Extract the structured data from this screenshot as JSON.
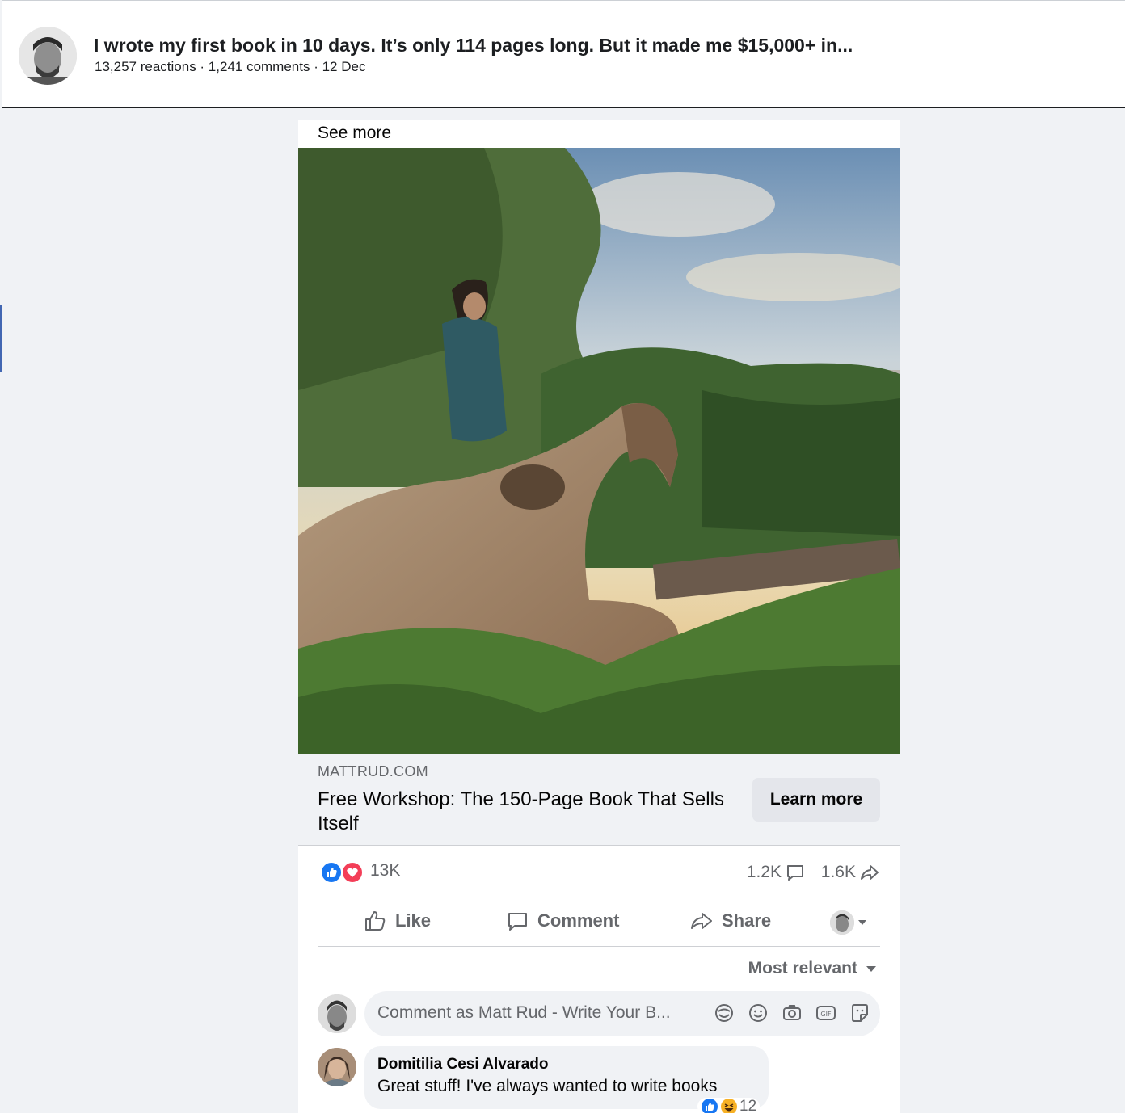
{
  "header": {
    "title": "I wrote my first book in 10 days. It’s only 114 pages long. But it made me $15,000+ in...",
    "meta": "13,257 reactions · 1,241 comments · 12 Dec"
  },
  "post": {
    "see_more": "See more",
    "link": {
      "domain": "MATTRUD.COM",
      "title": "Free Workshop: The 150-Page Book That Sells Itself",
      "cta": "Learn more"
    },
    "stats": {
      "reactions": "13K",
      "comments": "1.2K",
      "shares": "1.6K"
    },
    "actions": {
      "like": "Like",
      "comment": "Comment",
      "share": "Share"
    },
    "sort": "Most relevant",
    "composer_placeholder": "Comment as Matt Rud - Write Your B...",
    "comment": {
      "author": "Domitilia Cesi Alvarado",
      "text": "Great stuff! I've always wanted to write books",
      "reaction_count": "12"
    }
  },
  "colors": {
    "like_blue": "#1877f2",
    "love_red": "#f33e58",
    "muted_text": "#65676b",
    "page_bg": "#f0f2f5"
  },
  "icons": [
    "like-icon",
    "comment-icon",
    "share-icon",
    "gif-icon",
    "camera-icon",
    "emoji-icon",
    "sticker-icon",
    "avatar-sticker-icon",
    "caret-down-icon"
  ]
}
